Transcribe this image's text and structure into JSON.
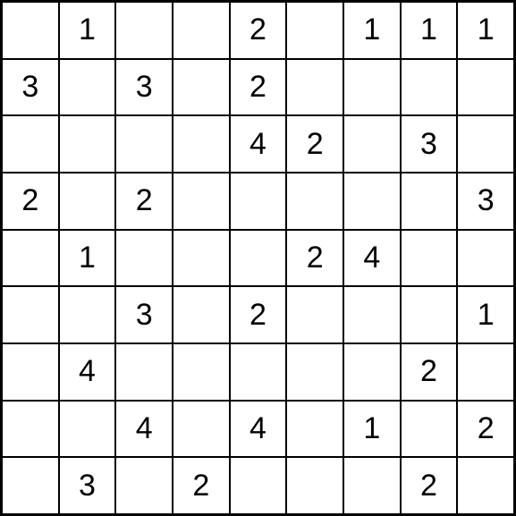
{
  "grid": {
    "rows": 9,
    "cols": 9,
    "cells": [
      [
        "",
        "1",
        "",
        "",
        "2",
        "",
        "1",
        "1",
        "1"
      ],
      [
        "3",
        "",
        "3",
        "",
        "2",
        "",
        "",
        "",
        ""
      ],
      [
        "",
        "",
        "",
        "",
        "4",
        "2",
        "",
        "3",
        ""
      ],
      [
        "2",
        "",
        "2",
        "",
        "",
        "",
        "",
        "",
        "3"
      ],
      [
        "",
        "1",
        "",
        "",
        "",
        "2",
        "4",
        "",
        ""
      ],
      [
        "",
        "",
        "3",
        "",
        "2",
        "",
        "",
        "",
        "1"
      ],
      [
        "",
        "4",
        "",
        "",
        "",
        "",
        "",
        "2",
        ""
      ],
      [
        "",
        "",
        "4",
        "",
        "4",
        "",
        "1",
        "",
        "2"
      ],
      [
        "",
        "3",
        "",
        "2",
        "",
        "",
        "",
        "2",
        ""
      ]
    ]
  }
}
